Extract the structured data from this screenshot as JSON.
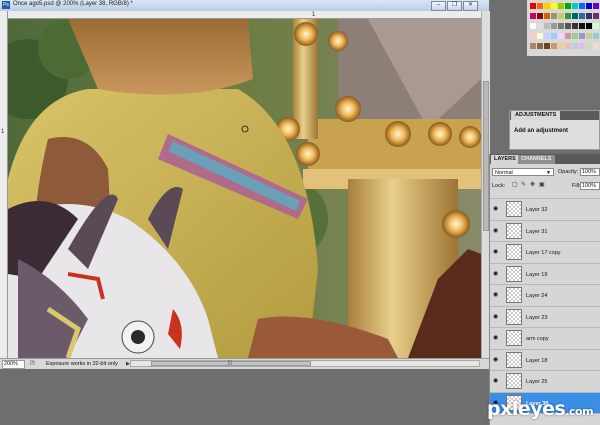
{
  "document": {
    "title": "Once ago5.psd @ 200% (Layer 38, RGB/8) *",
    "app_icon": "Ps",
    "window_buttons": [
      "minimize",
      "restore",
      "close"
    ],
    "ruler_top_mark": "1",
    "ruler_left_mark": "1",
    "status": {
      "zoom": "200%",
      "info": "Exposure works in 32-bit only"
    }
  },
  "panels": {
    "adjustments": {
      "tab_label": "ADJUSTMENTS",
      "heading": "Add an adjustment"
    },
    "layers": {
      "tabs": [
        "LAYERS",
        "CHANNELS"
      ],
      "blend_mode": "Normal",
      "opacity_label": "Opacity:",
      "opacity_value": "100%",
      "lock_label": "Lock:",
      "fill_label": "Fill:",
      "fill_value": "100%",
      "items": [
        {
          "name": "Layer 32",
          "visible": true
        },
        {
          "name": "Layer 31",
          "visible": true
        },
        {
          "name": "Layer 17 copy",
          "visible": true
        },
        {
          "name": "Layer 19",
          "visible": true
        },
        {
          "name": "Layer 24",
          "visible": true
        },
        {
          "name": "Layer 23",
          "visible": true
        },
        {
          "name": "arm copy",
          "visible": true
        },
        {
          "name": "Layer 18",
          "visible": true
        },
        {
          "name": "Layer 25",
          "visible": true
        },
        {
          "name": "Layer 38",
          "visible": true,
          "selected": true
        }
      ]
    }
  },
  "watermark": {
    "brand": "pxleyes",
    "tld": ".com"
  },
  "colors": {
    "selected_layer": "#3a8ee6",
    "panel_bg": "#d6d6d6",
    "workspace": "#6e6e6e"
  }
}
